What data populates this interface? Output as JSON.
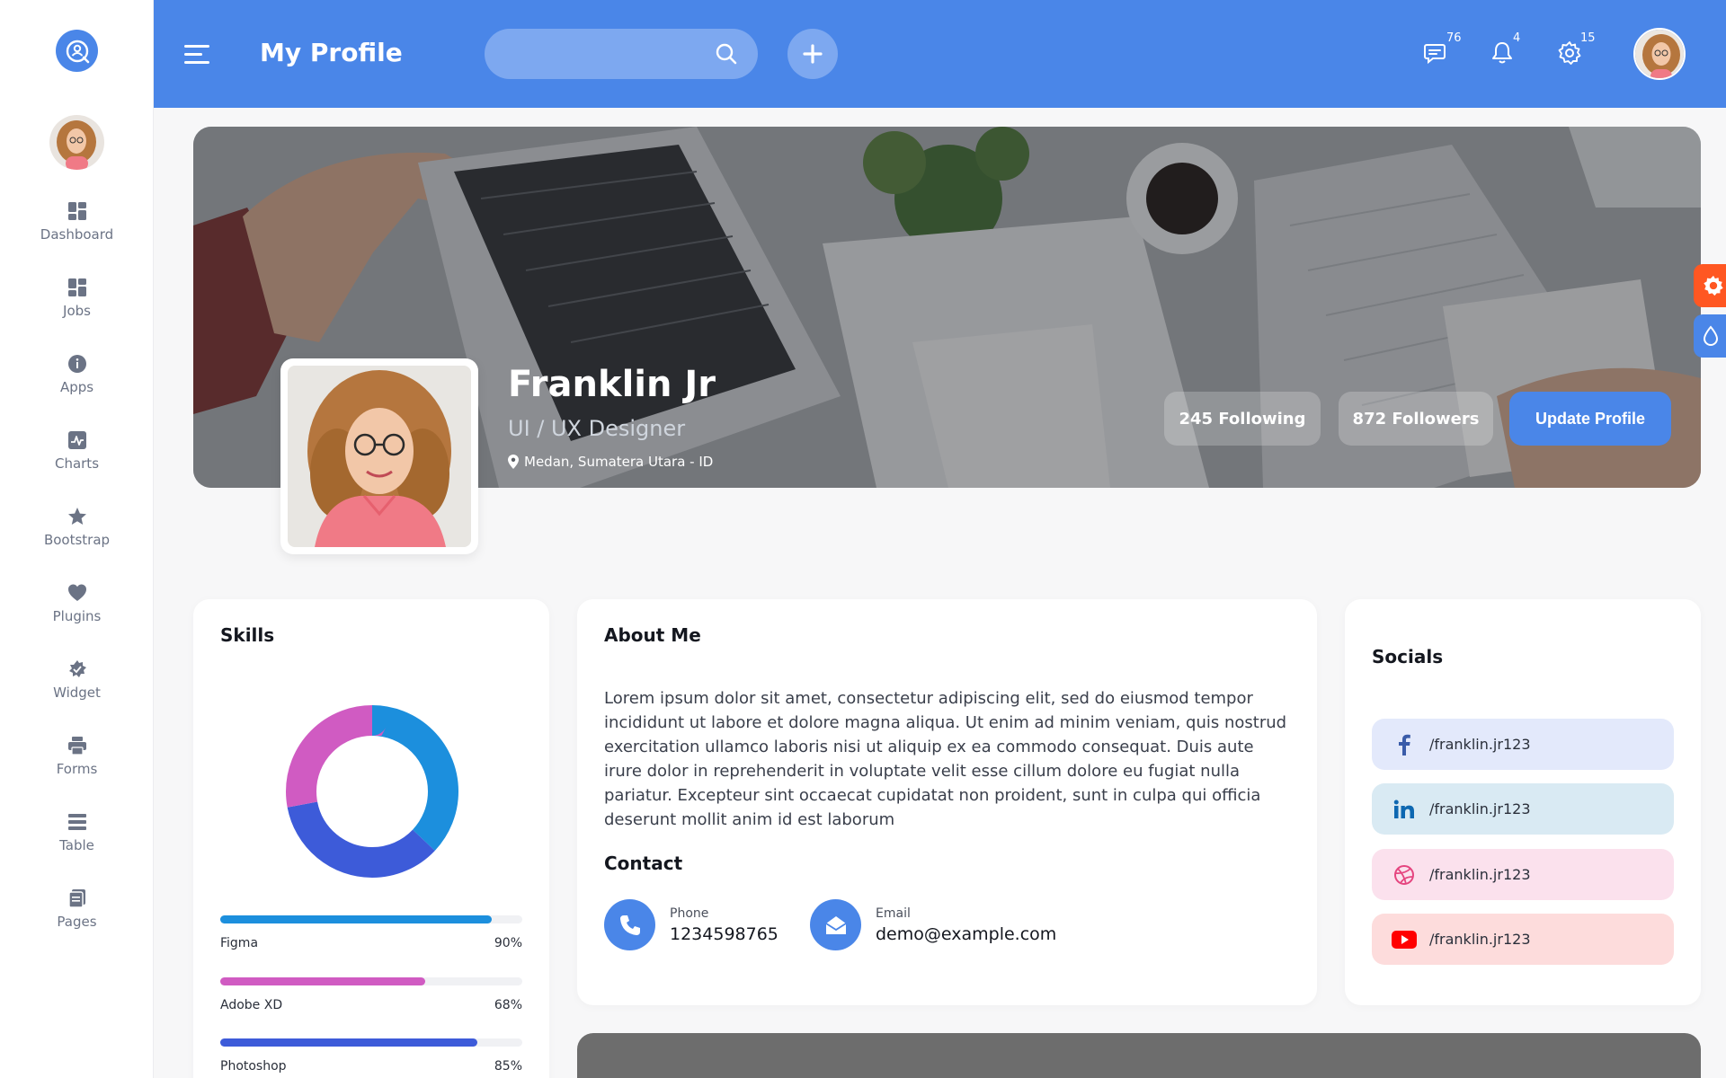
{
  "header": {
    "title": "My Profile",
    "search_placeholder": "",
    "icons": [
      {
        "name": "chat-icon",
        "badge": "76"
      },
      {
        "name": "bell-icon",
        "badge": "4"
      },
      {
        "name": "gear-icon",
        "badge": "15"
      }
    ]
  },
  "sidebar": {
    "items": [
      {
        "label": "Dashboard",
        "icon": "grid-icon"
      },
      {
        "label": "Jobs",
        "icon": "grid-icon"
      },
      {
        "label": "Apps",
        "icon": "info-icon"
      },
      {
        "label": "Charts",
        "icon": "chart-icon"
      },
      {
        "label": "Bootstrap",
        "icon": "star-icon"
      },
      {
        "label": "Plugins",
        "icon": "heart-icon"
      },
      {
        "label": "Widget",
        "icon": "widget-icon"
      },
      {
        "label": "Forms",
        "icon": "printer-icon"
      },
      {
        "label": "Table",
        "icon": "table-icon"
      },
      {
        "label": "Pages",
        "icon": "pages-icon"
      }
    ]
  },
  "profile": {
    "name": "Franklin Jr",
    "role": "UI / UX Designer",
    "location": "Medan, Sumatera Utara - ID",
    "following": "245 Following",
    "followers": "872 Followers",
    "update_label": "Update Profile"
  },
  "skills": {
    "title": "Skills",
    "items": [
      {
        "name": "Figma",
        "percent": "90%",
        "value": 90,
        "color": "#1c8fdd"
      },
      {
        "name": "Adobe XD",
        "percent": "68%",
        "value": 68,
        "color": "#d05bc2"
      },
      {
        "name": "Photoshop",
        "percent": "85%",
        "value": 85,
        "color": "#3d5bd9"
      }
    ]
  },
  "about": {
    "title": "About Me",
    "text": "Lorem ipsum dolor sit amet, consectetur adipiscing elit, sed do eiusmod tempor incididunt ut labore et dolore magna aliqua. Ut enim ad minim veniam, quis nostrud exercitation ullamco laboris nisi ut aliquip ex ea commodo consequat. Duis aute irure dolor in reprehenderit in voluptate velit esse cillum dolore eu fugiat nulla pariatur. Excepteur sint occaecat cupidatat non proident, sunt in culpa qui officia deserunt mollit anim id est laborum",
    "contact_title": "Contact",
    "phone_label": "Phone",
    "phone": "1234598765",
    "email_label": "Email",
    "email": "demo@example.com"
  },
  "socials": {
    "title": "Socials",
    "items": [
      {
        "network": "facebook",
        "handle": "/franklin.jr123",
        "bg": "#e3e9fb"
      },
      {
        "network": "linkedin",
        "handle": "/franklin.jr123",
        "bg": "#d9eaf3"
      },
      {
        "network": "dribbble",
        "handle": "/franklin.jr123",
        "bg": "#fbe1ed"
      },
      {
        "network": "youtube",
        "handle": "/franklin.jr123",
        "bg": "#fddcdc"
      }
    ]
  },
  "colors": {
    "primary": "#4a86e8",
    "accent_orange": "#ff5722"
  }
}
